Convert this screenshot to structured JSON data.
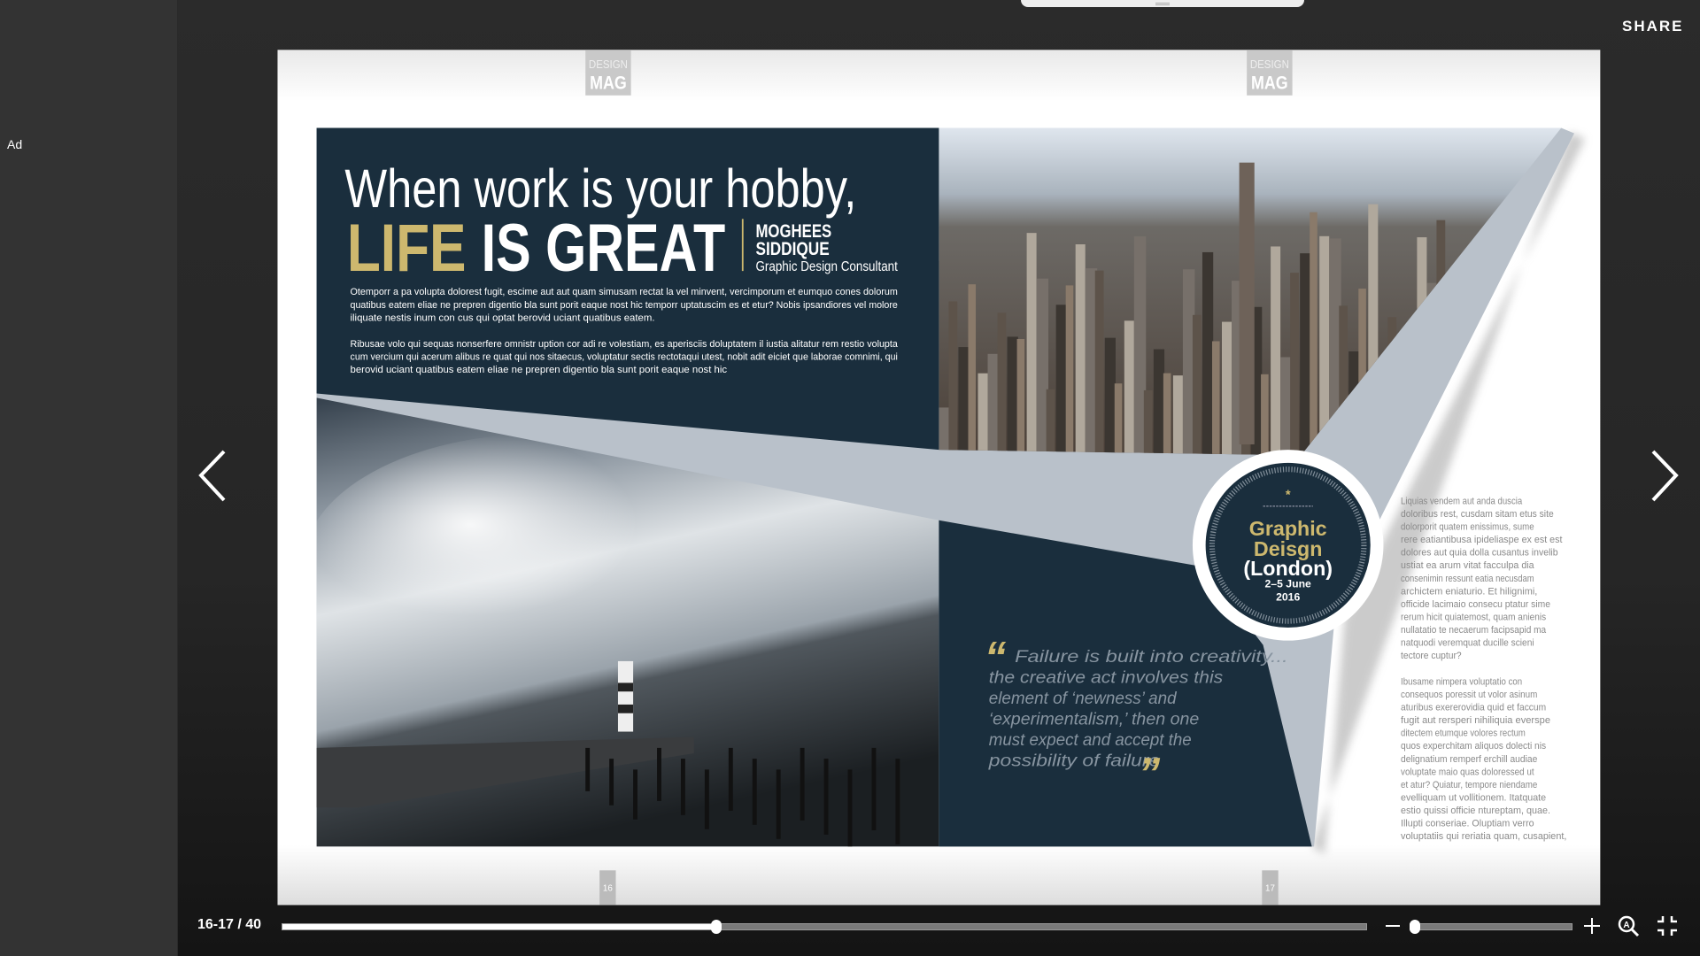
{
  "sidebar": {
    "ad_label": "Ad"
  },
  "header": {
    "share_label": "SHARE"
  },
  "viewer": {
    "page_label": "16-17 / 40",
    "progress_fraction": 0.4,
    "zoom_fraction": 0.03
  },
  "magazine": {
    "logo_top": "DESIGN",
    "logo_bottom": "MAG",
    "page_left": "16",
    "page_right": "17",
    "headline_1": "When work is your hobby,",
    "headline_gold": "LIFE",
    "headline_white": "IS GREAT",
    "author_first": "MOGHEES",
    "author_last": "SIDDIQUE",
    "author_role": "Graphic Design Consultant",
    "body_lines": [
      "Otemporr a pa volupta dolorest fugit, escime aut aut quam simusam rectat la vel minvent, vercimporum et eumquo cones dolorum",
      "quatibus eatem eliae ne prepren digentio bla sunt porit eaque nost hic temporr uptatuscim es et etur? Nobis ipsandiores vel molore",
      "iliquate nestis inum con cus qui optat berovid uciant quatibus eatem.",
      "",
      "Ribusae volo qui sequas nonserfere omnistr uption cor adi re volestiam, es aperisciis doluptatem il iustia alitatur rem restio volupta",
      "cum vercium qui acerum alibus re quat qui nos sitaecus, voluptatur sectis rectotaqui utest, nobit adit eiciet que laborae comnimi, qui",
      "berovid uciant quatibus eatem eliae ne prepren digentio bla sunt porit eaque nost hic"
    ],
    "badge": {
      "star": "*",
      "line1": "Graphic",
      "line2": "Deisgn",
      "line3": "(London)",
      "line4": "2–5 June",
      "line5": "2016"
    },
    "quote_open": "“",
    "quote_close": "”",
    "quote_lines": [
      "Failure is built into creativity...",
      "the creative act involves this",
      "element of ‘newness’ and",
      "‘experimentalism,’ then one",
      "must expect and accept the",
      "possibility of failure"
    ],
    "column_lines": [
      "Liquias vendem aut anda duscia",
      "doloribus rest, cusdam sitam etus site",
      "dolorporit quatem enissimus, sume",
      "rere eatiantibusa ipideliaspe ex est est",
      "dolores aut quia dolla cusantus invelib",
      "ustiat ea arum vitat facculpa dia",
      "consenimin ressunt eatia necusdam",
      "archictem eniaturio. Et hilignimi,",
      "officide lacimaio consecu ptatur sime",
      "rerum hicit quiatemost, quam anienis",
      "nullatatio te necaerum facipsapid ma",
      "natquodi veremquat ducille scieni",
      "tectore cuptur?",
      "",
      "Ibusame nimpera voluptatio con",
      "consequos poressit ut volor asinum",
      "aturibus exererovidia quid et faccum",
      "fugit aut rersperi nihiliquia everspe",
      "ditectem etumque volores rectum",
      "quos experchitam aliquos dolecti nis",
      "delignatium remperf erchill audiae",
      "voluptate maio quas doloressed ut",
      "et atur? Quiatur, tempore niendame",
      "evelliquam ut vollitionem. Itatquate",
      "estio quissi officie ntureptam, quae.",
      "Illupti conseriae. Oluptiam verro",
      "voluptatiis qui reriatia quam, cusapient,"
    ]
  },
  "colors": {
    "navy": "#1a2e3d",
    "gold": "#cdb86e",
    "wedge": "#b9c1ca"
  }
}
